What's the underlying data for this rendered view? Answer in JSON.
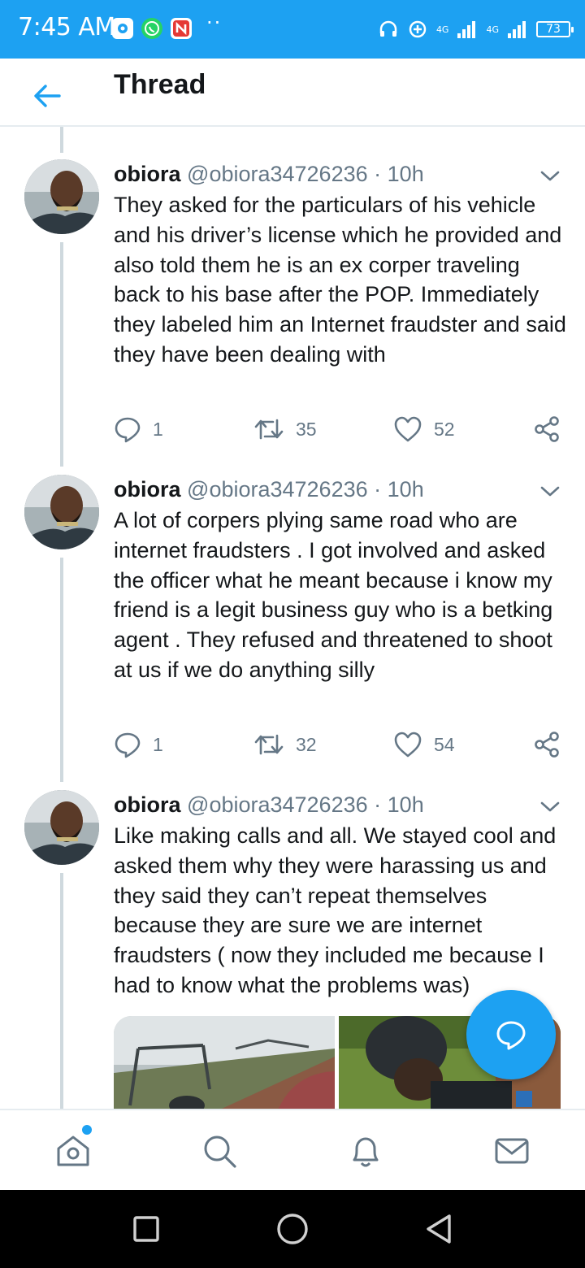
{
  "status_bar": {
    "time": "7:45 AM",
    "network_1": "4G",
    "network_2": "4G",
    "battery": "73",
    "icons": [
      "settings-app-icon",
      "whatsapp-icon",
      "news-app-icon",
      "headphones-icon",
      "data-saver-icon",
      "signal-icon",
      "battery-icon"
    ]
  },
  "header": {
    "title": "Thread",
    "back_icon": "arrow-left-icon"
  },
  "tweets": [
    {
      "name": "obiora",
      "handle": "@obiora34726236",
      "separator": "·",
      "time": "10h",
      "text": "They asked for the particulars of his vehicle and his driver’s license which he provided and also told them he is an ex corper traveling back to his base after the POP. Immediately they labeled him an Internet fraudster and said they have been dealing with",
      "replies": "1",
      "retweets": "35",
      "likes": "52"
    },
    {
      "name": "obiora",
      "handle": "@obiora34726236",
      "separator": "·",
      "time": "10h",
      "text": "A lot of corpers plying same road who are internet fraudsters . I got involved and asked the officer what he meant because i know my friend is a legit business guy who is a betking agent . They refused and threatened to shoot at us if we do anything silly",
      "replies": "1",
      "retweets": "32",
      "likes": "54"
    },
    {
      "name": "obiora",
      "handle": "@obiora34726236",
      "separator": "·",
      "time": "10h",
      "text": "Like making calls and all. We stayed cool and asked them why they were harassing us and they said they can’t repeat themselves because they are sure we are internet fraudsters ( now they included me because I had to know what the problems was)"
    }
  ],
  "colors": {
    "accent": "#1da1f2",
    "text": "#14171a",
    "secondary": "#657786",
    "divider": "#e6ecf0"
  },
  "bottom_nav": {
    "items": [
      "home-icon",
      "search-icon",
      "notifications-icon",
      "messages-icon"
    ],
    "home_has_dot": true
  },
  "system_nav": [
    "recents-square-icon",
    "home-circle-icon",
    "back-triangle-icon"
  ]
}
